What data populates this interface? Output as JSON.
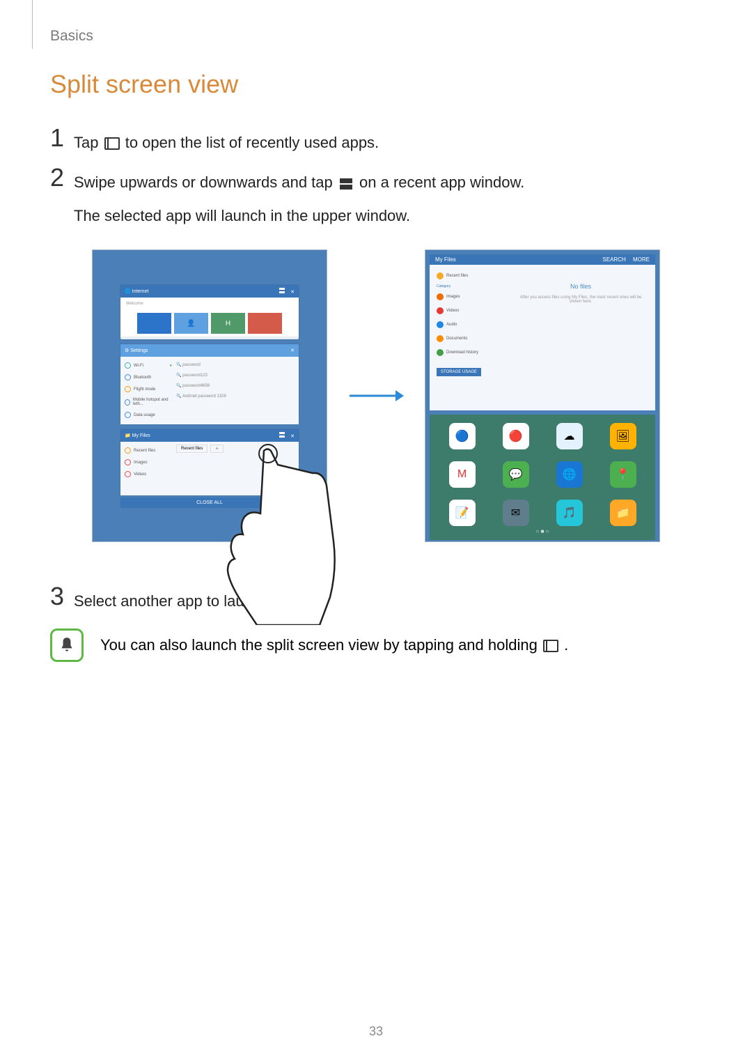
{
  "header": {
    "section": "Basics"
  },
  "heading": "Split screen view",
  "steps": [
    {
      "num": "1",
      "pre": "Tap ",
      "post": " to open the list of recently used apps."
    },
    {
      "num": "2",
      "line1_pre": "Swipe upwards or downwards and tap ",
      "line1_post": " on a recent app window.",
      "line2": "The selected app will launch in the upper window."
    },
    {
      "num": "3",
      "text": "Select another app to launch."
    }
  ],
  "note": {
    "pre": "You can also launch the split screen view by tapping and holding ",
    "post": "."
  },
  "pageNumber": "33",
  "mock1": {
    "apps": {
      "internet": {
        "title": "Internet",
        "welcome": "Welcome"
      },
      "settings": {
        "title": "Settings",
        "sidebar": [
          "Wi-Fi",
          "Bluetooth",
          "Flight mode",
          "Mobile hotspot and teth...",
          "Data usage"
        ],
        "search1": "password",
        "search2": "password123",
        "search3": "password4656",
        "search4": "Android password 1328"
      },
      "myfiles": {
        "title": "My Files",
        "sidebar": [
          "Recent files",
          "Images",
          "Videos"
        ],
        "tab": "Recent files",
        "plus": "+"
      }
    },
    "closeAll": "CLOSE ALL"
  },
  "mock2": {
    "topApp": {
      "title": "My Files",
      "search": "SEARCH",
      "more": "MORE",
      "sidebar": [
        "Recent files",
        "Images",
        "Videos",
        "Audio",
        "Documents",
        "Download history"
      ],
      "category": "Category",
      "storage": "STORAGE USAGE",
      "emptyTitle": "No files",
      "emptyMsg": "After you access files using My Files, the most recent ones will be shown here."
    },
    "appGrid": [
      "Chrome",
      "YouTube",
      "Drive",
      "Gallery",
      "Gmail",
      "Hangouts",
      "Internet",
      "Maps",
      "Memo",
      "Email",
      "Music",
      "My Files"
    ]
  }
}
